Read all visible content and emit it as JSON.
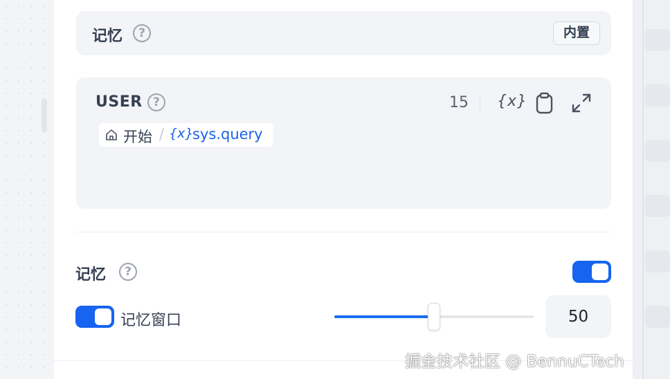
{
  "memory_section": {
    "label": "记忆",
    "help_icon": "question-circle-icon",
    "badge": "内置"
  },
  "user_prompt": {
    "role_label": "USER",
    "help_icon": "question-circle-icon",
    "char_count": "15",
    "actions": [
      {
        "name": "insert-variable",
        "icon": "variable-braces-icon",
        "glyph": "{x}"
      },
      {
        "name": "copy",
        "icon": "clipboard-icon"
      },
      {
        "name": "expand",
        "icon": "expand-arrows-icon"
      }
    ],
    "variable_chip": {
      "node_icon": "home-icon",
      "node_label": "开始",
      "separator": "/",
      "var_icon": "variable-braces-icon",
      "var_glyph": "{x}",
      "var_name": "sys.query"
    }
  },
  "memory_settings": {
    "label": "记忆",
    "help_icon": "question-circle-icon",
    "enabled": true,
    "window": {
      "label": "记忆窗口",
      "enabled": true,
      "value": "50",
      "slider_fraction": 0.5
    }
  },
  "watermark": "掘金技术社区 @ BennuCTech",
  "colors": {
    "accent": "#1664ef",
    "card_bg": "#f2f4f7",
    "text_primary": "#354052",
    "text_muted": "#9ea4ae"
  }
}
